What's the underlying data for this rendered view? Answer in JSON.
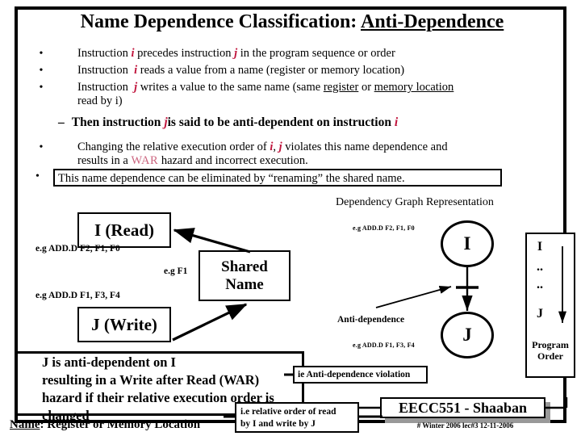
{
  "slide": {
    "title_main": "Name Dependence Classification:",
    "title_underlined": "Anti-Dependence"
  },
  "bullets": [
    {
      "marker": "•",
      "pre": "Instruction",
      "var1": "i",
      "mid": "precedes instruction",
      "var2": "j",
      "post": "in the program sequence or order"
    },
    {
      "marker": "•",
      "pre": "Instruction",
      "var1": "i",
      "post": "reads a value from a name (register or memory location)"
    },
    {
      "marker": "•",
      "pre": "Instruction",
      "var1": "j",
      "post": "writes a value to the same name (same",
      "u1": "register",
      "conj": "or",
      "u2": "memory location",
      "tail": "read by i)"
    }
  ],
  "sub_bullet": {
    "dash": "–",
    "pre": "Then instruction",
    "var1": "j",
    "mid": "is said to be anti-dependent on instruction",
    "var2": "i"
  },
  "bullet4": {
    "marker": "•",
    "pre": "Changing the relative execution order of",
    "var1": "i",
    "comma": ",",
    "var2": "j",
    "post": "violates this name dependence and",
    "line2_pre": "results in a",
    "hazard": "WAR",
    "line2_post": "hazard and incorrect execution."
  },
  "bullet5": {
    "marker": "•",
    "text": "This name dependence can be eliminated by “renaming” the shared name."
  },
  "left_diagram": {
    "box_i": "I (Read)",
    "box_j": "J (Write)",
    "box_shared_line1": "Shared",
    "box_shared_line2": "Name",
    "eg_read": "e.g  ADD.D  F2, F1, F0",
    "eg_write": "e.g  ADD.D  F1, F3, F4",
    "eg_shared": "e.g F1"
  },
  "right_diagram": {
    "heading": "Dependency Graph Representation",
    "node_i": "I",
    "node_j": "J",
    "eg_i": "e.g  ADD.D  F2, F1, F0",
    "eg_j": "e.g  ADD.D  F1, F3, F4",
    "anti_dependence_label": "Anti-dependence"
  },
  "program_order": {
    "item_i": "I",
    "dots1": "..",
    "dots2": "..",
    "item_j": "J",
    "label_line1": "Program",
    "label_line2": "Order"
  },
  "conclusion": {
    "line1": "J is anti-dependent on I",
    "line2": "resulting in a Write after Read (WAR)",
    "line3": "hazard if their relative execution order is changed"
  },
  "callouts": {
    "violation": "ie Anti-dependence violation",
    "rel_order_line1": "i.e relative order of read",
    "rel_order_line2": "by I and write by J"
  },
  "name_line": {
    "underlined": "Name",
    "rest": ": Register  or  Memory Location"
  },
  "footer": {
    "banner": "EECC551 - Shaaban",
    "sub": "#  Winter 2006  lec#3    12-11-2006"
  },
  "colors": {
    "var_accent": "#c0143c",
    "hazard_accent": "#cc6680",
    "ink": "#000000",
    "shadow": "#999999"
  }
}
